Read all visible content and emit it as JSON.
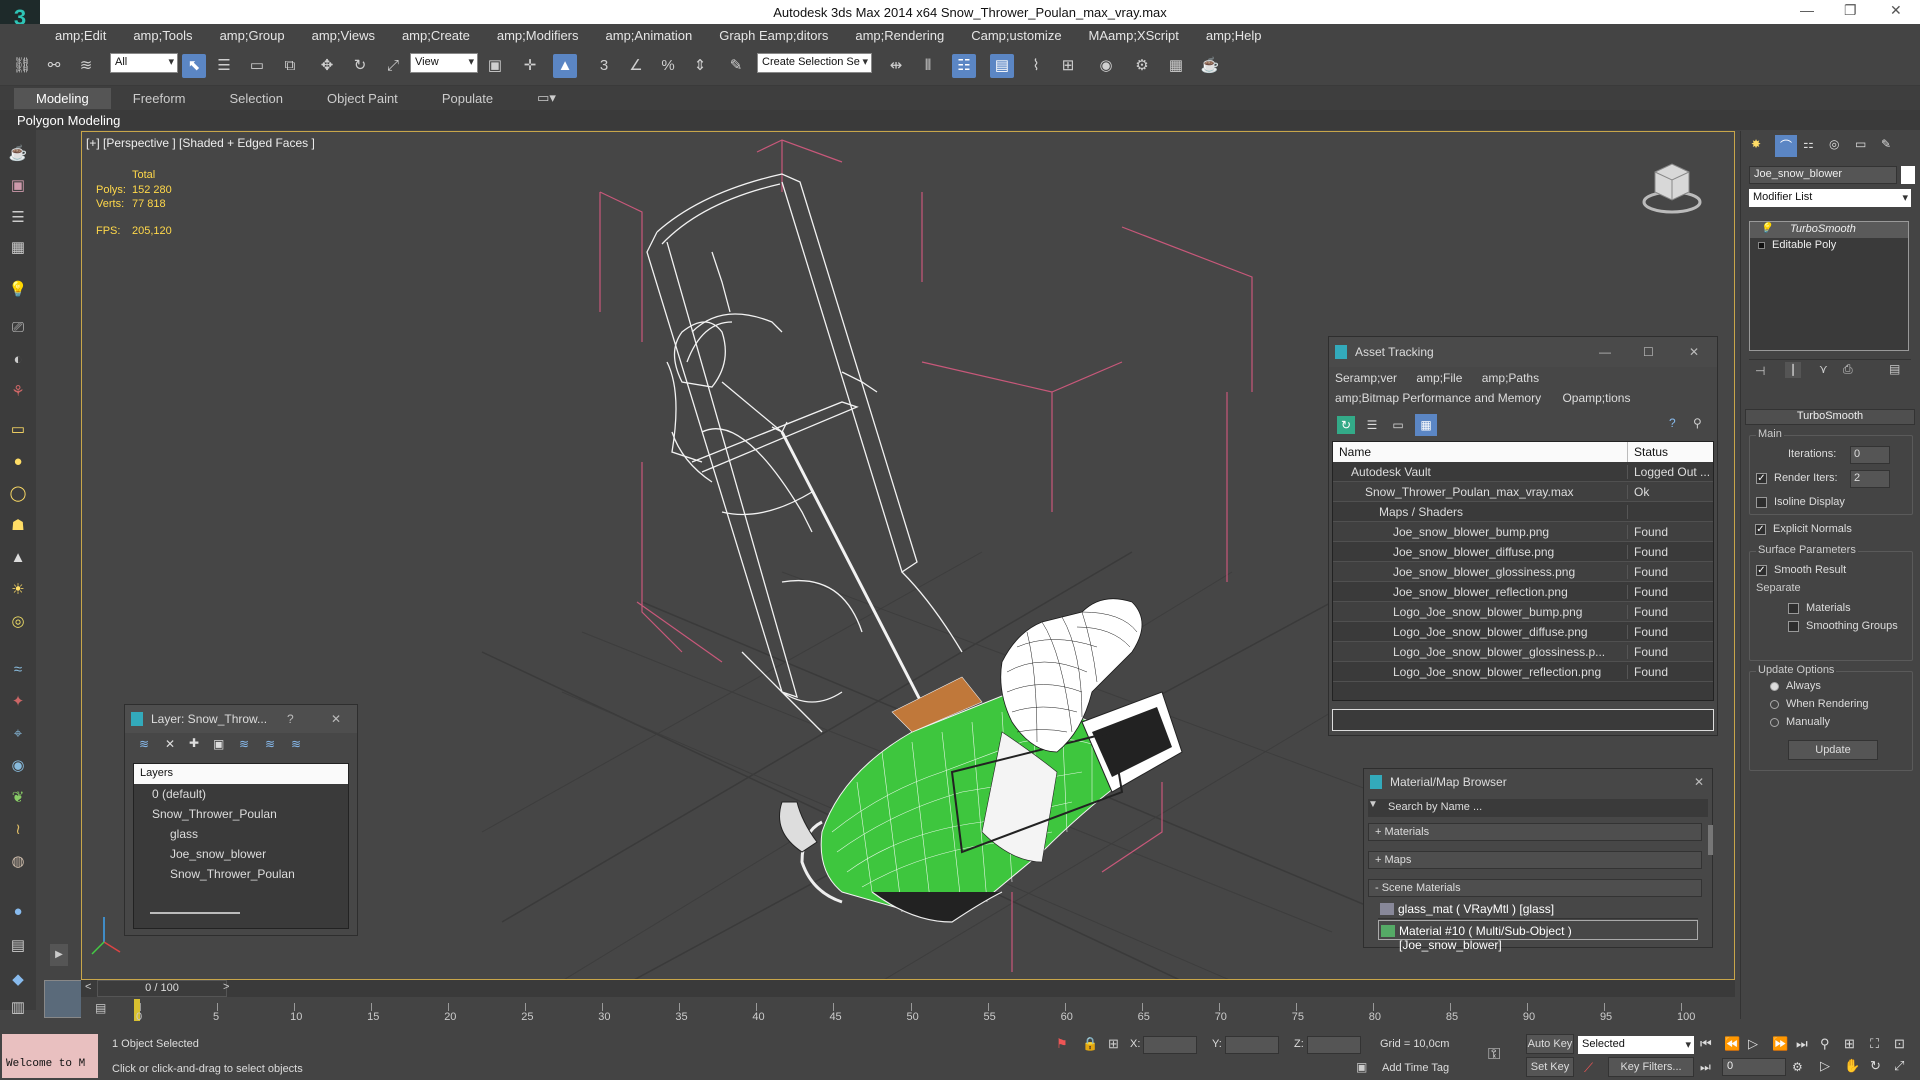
{
  "app": {
    "title": "Autodesk 3ds Max  2014 x64     Snow_Thrower_Poulan_max_vray.max",
    "logo": "3"
  },
  "menu": [
    "amp;Edit",
    "amp;Tools",
    "amp;Group",
    "amp;Views",
    "amp;Create",
    "amp;Modifiers",
    "amp;Animation",
    "Graph Eamp;ditors",
    "amp;Rendering",
    "Camp;ustomize",
    "MAamp;XScript",
    "amp;Help"
  ],
  "toolbar": {
    "filter": "All",
    "refcoord": "View",
    "selset": "Create Selection Se"
  },
  "ribbon": {
    "tabs": [
      "Modeling",
      "Freeform",
      "Selection",
      "Object Paint",
      "Populate"
    ],
    "sub": "Polygon Modeling"
  },
  "viewport": {
    "label": "[+] [Perspective ] [Shaded + Edged Faces ]",
    "total": "Total",
    "polys_label": "Polys:",
    "polys": "152 280",
    "verts_label": "Verts:",
    "verts": "77 818",
    "fps_label": "FPS:",
    "fps": "205,120"
  },
  "asset": {
    "title": "Asset Tracking",
    "menu1": [
      "Seramp;ver",
      "amp;File",
      "amp;Paths"
    ],
    "menu2": [
      "amp;Bitmap Performance and Memory",
      "Opamp;tions"
    ],
    "col_name": "Name",
    "col_status": "Status",
    "rows": [
      {
        "name": "Autodesk Vault",
        "status": "Logged Out ...",
        "indent": 1
      },
      {
        "name": "Snow_Thrower_Poulan_max_vray.max",
        "status": "Ok",
        "indent": 2
      },
      {
        "name": "Maps / Shaders",
        "status": "",
        "indent": 3
      },
      {
        "name": "Joe_snow_blower_bump.png",
        "status": "Found",
        "indent": 4
      },
      {
        "name": "Joe_snow_blower_diffuse.png",
        "status": "Found",
        "indent": 4
      },
      {
        "name": "Joe_snow_blower_glossiness.png",
        "status": "Found",
        "indent": 4
      },
      {
        "name": "Joe_snow_blower_reflection.png",
        "status": "Found",
        "indent": 4
      },
      {
        "name": "Logo_Joe_snow_blower_bump.png",
        "status": "Found",
        "indent": 4
      },
      {
        "name": "Logo_Joe_snow_blower_diffuse.png",
        "status": "Found",
        "indent": 4
      },
      {
        "name": "Logo_Joe_snow_blower_glossiness.p...",
        "status": "Found",
        "indent": 4
      },
      {
        "name": "Logo_Joe_snow_blower_reflection.png",
        "status": "Found",
        "indent": 4
      }
    ]
  },
  "layer": {
    "title": "Layer: Snow_Throw...",
    "help": "?",
    "header": "Layers",
    "items": [
      {
        "name": "0 (default)",
        "indent": 1
      },
      {
        "name": "Snow_Thrower_Poulan",
        "indent": 1
      },
      {
        "name": "glass",
        "indent": 2
      },
      {
        "name": "Joe_snow_blower",
        "indent": 2
      },
      {
        "name": "Snow_Thrower_Poulan",
        "indent": 2
      }
    ]
  },
  "matbrowser": {
    "title": "Material/Map Browser",
    "search": "Search by Name ...",
    "groups": [
      "+ Materials",
      "+ Maps",
      "- Scene Materials"
    ],
    "items": [
      "glass_mat  ( VRayMtl )  [glass]",
      "Material #10  ( Multi/Sub-Object )  [Joe_snow_blower]"
    ]
  },
  "right": {
    "object": "Joe_snow_blower",
    "modlist": "Modifier List",
    "stack": [
      "TurboSmooth",
      "Editable Poly"
    ],
    "rollout": "TurboSmooth",
    "main": "Main",
    "iterations_label": "Iterations:",
    "iterations": "0",
    "render_iters_label": "Render Iters:",
    "render_iters": "2",
    "isoline": "Isoline Display",
    "explicit": "Explicit Normals",
    "surface": "Surface Parameters",
    "smooth": "Smooth Result",
    "separate": "Separate",
    "materials": "Materials",
    "sgroups": "Smoothing Groups",
    "update_opts": "Update Options",
    "always": "Always",
    "when_render": "When Rendering",
    "manually": "Manually",
    "update": "Update"
  },
  "timeline": {
    "frame": "0 / 100",
    "ticks": [
      "0",
      "5",
      "10",
      "15",
      "20",
      "25",
      "30",
      "35",
      "40",
      "45",
      "50",
      "55",
      "60",
      "65",
      "70",
      "75",
      "80",
      "85",
      "90",
      "95",
      "100"
    ]
  },
  "status": {
    "welcome": "Welcome to M",
    "selected": "1 Object Selected",
    "prompt": "Click or click-and-drag to select objects",
    "x": "X:",
    "y": "Y:",
    "z": "Z:",
    "grid": "Grid = 10,0cm",
    "autokey": "Auto Key",
    "setkey": "Set Key",
    "keymode": "Selected",
    "keyfilters": "Key Filters...",
    "addtime": "Add Time Tag",
    "frame": "0"
  }
}
